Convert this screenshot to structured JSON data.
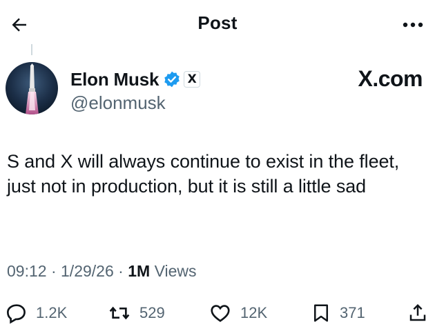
{
  "header": {
    "title": "Post"
  },
  "author": {
    "display_name": "Elon Musk",
    "handle": "@elonmusk",
    "affiliation_badge": "X",
    "verified_color": "#1d9bf0"
  },
  "watermark": "X.com",
  "post": {
    "text": "S and X will always continue to exist in the fleet, just not in production, but it is still a little sad",
    "time": "09:12",
    "date": "1/29/26",
    "separator": "·",
    "views_count": "1M",
    "views_label": "Views"
  },
  "actions": {
    "replies": "1.2K",
    "reposts": "529",
    "likes": "12K",
    "bookmarks": "371"
  },
  "icons": {
    "back": "arrow-left-icon",
    "more": "more-horizontal-icon",
    "verified": "verified-badge-icon",
    "reply": "reply-icon",
    "repost": "repost-icon",
    "like": "heart-icon",
    "bookmark": "bookmark-icon",
    "share": "share-icon"
  }
}
